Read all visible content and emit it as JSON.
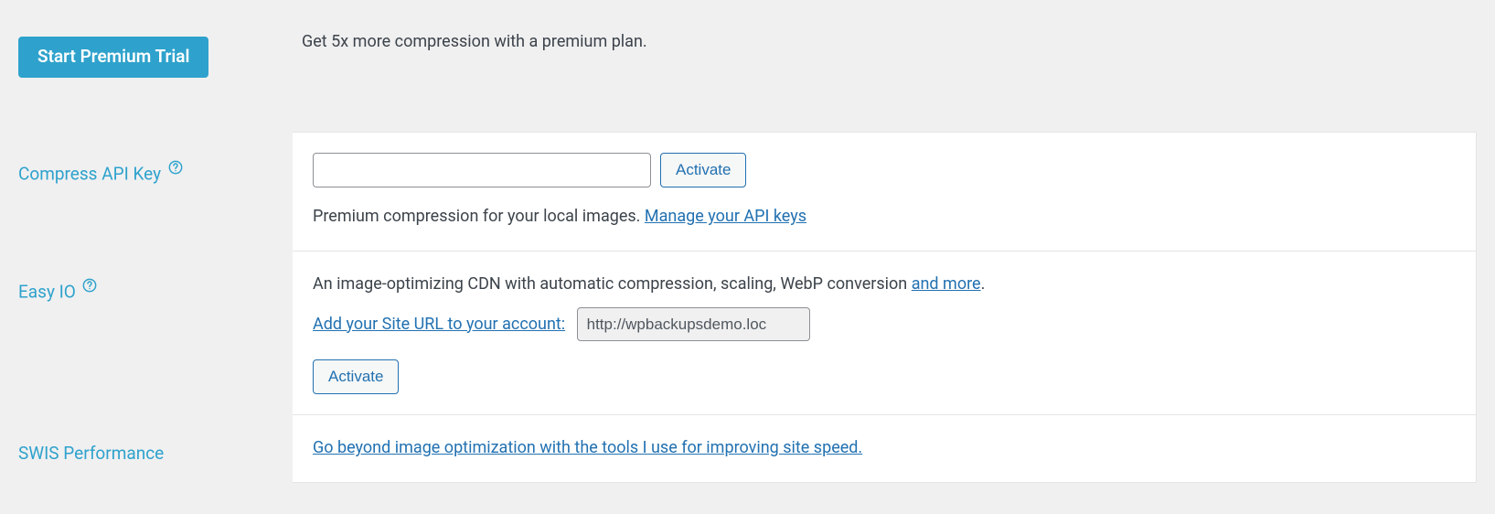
{
  "premium": {
    "button_label": "Start Premium Trial",
    "description": "Get 5x more compression with a premium plan."
  },
  "compress_api": {
    "label": "Compress API Key",
    "activate_label": "Activate",
    "description_prefix": "Premium compression for your local images. ",
    "manage_link": "Manage your API keys"
  },
  "easy_io": {
    "label": "Easy IO",
    "description_prefix": "An image-optimizing CDN with automatic compression, scaling, WebP conversion ",
    "and_more": "and more",
    "description_suffix": ".",
    "add_url_label": "Add your Site URL to your account:",
    "site_url_value": "http://wpbackupsdemo.loc",
    "activate_label": "Activate"
  },
  "swis": {
    "label": "SWIS Performance",
    "link_text": "Go beyond image optimization with the tools I use for improving site speed."
  }
}
